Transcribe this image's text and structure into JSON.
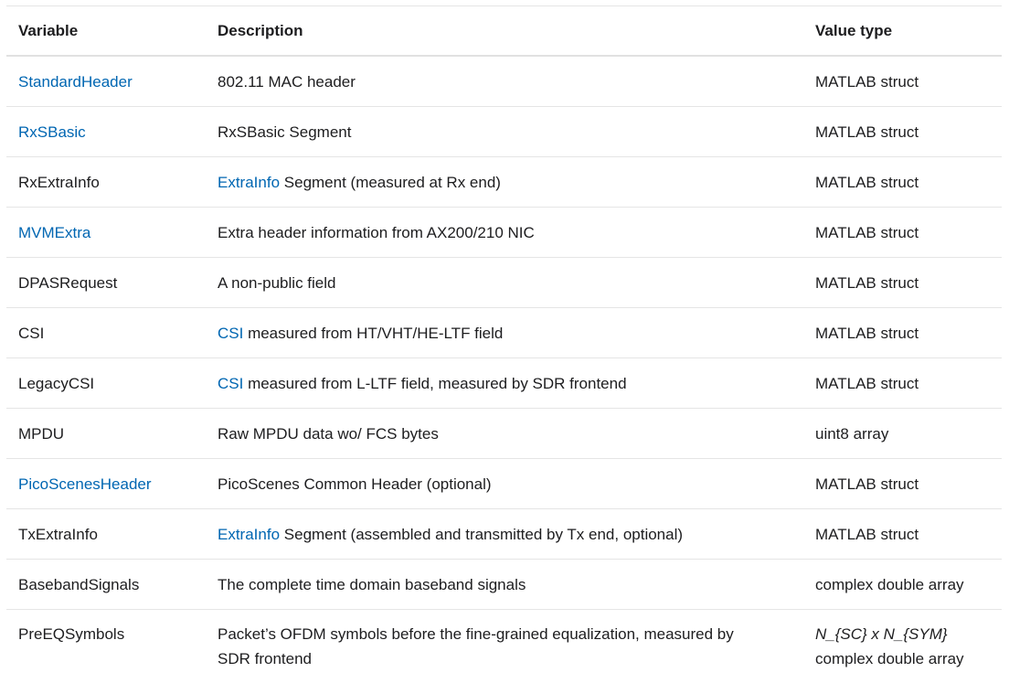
{
  "colors": {
    "link": "#0066b2",
    "text": "#1d1d1f",
    "border": "#e5e5e5"
  },
  "headers": {
    "variable": "Variable",
    "description": "Description",
    "value_type": "Value type"
  },
  "rows": [
    {
      "variable": "StandardHeader",
      "variable_is_link": true,
      "desc_link": "",
      "desc_text": "802.11 MAC header",
      "value_type": "MATLAB struct"
    },
    {
      "variable": "RxSBasic",
      "variable_is_link": true,
      "desc_link": "",
      "desc_text": "RxSBasic Segment",
      "value_type": "MATLAB struct"
    },
    {
      "variable": "RxExtraInfo",
      "variable_is_link": false,
      "desc_link": "ExtraInfo",
      "desc_text": " Segment (measured at Rx end)",
      "value_type": "MATLAB struct"
    },
    {
      "variable": "MVMExtra",
      "variable_is_link": true,
      "desc_link": "",
      "desc_text": "Extra header information from AX200/210 NIC",
      "value_type": "MATLAB struct"
    },
    {
      "variable": "DPASRequest",
      "variable_is_link": false,
      "desc_link": "",
      "desc_text": "A non-public field",
      "value_type": "MATLAB struct"
    },
    {
      "variable": "CSI",
      "variable_is_link": false,
      "desc_link": "CSI",
      "desc_text": " measured from HT/VHT/HE-LTF field",
      "value_type": "MATLAB struct"
    },
    {
      "variable": "LegacyCSI",
      "variable_is_link": false,
      "desc_link": "CSI",
      "desc_text": " measured from L-LTF field, measured by SDR frontend",
      "value_type": "MATLAB struct"
    },
    {
      "variable": "MPDU",
      "variable_is_link": false,
      "desc_link": "",
      "desc_text": "Raw MPDU data wo/ FCS bytes",
      "value_type": "uint8 array"
    },
    {
      "variable": "PicoScenesHeader",
      "variable_is_link": true,
      "desc_link": "",
      "desc_text": "PicoScenes Common Header (optional)",
      "value_type": "MATLAB struct"
    },
    {
      "variable": "TxExtraInfo",
      "variable_is_link": false,
      "desc_link": "ExtraInfo",
      "desc_text": " Segment (assembled and transmitted by Tx end, optional)",
      "value_type": "MATLAB struct"
    },
    {
      "variable": "BasebandSignals",
      "variable_is_link": false,
      "desc_link": "",
      "desc_text": "The complete time domain baseband signals",
      "value_type": "complex double array"
    }
  ],
  "last_row": {
    "variable": "PreEQSymbols",
    "desc_line1": "Packet’s OFDM symbols before the fine-grained equalization, measured by",
    "desc_line2": "SDR frontend",
    "value_math": "N_{SC} x N_{SYM}",
    "value_type": "complex double array"
  }
}
